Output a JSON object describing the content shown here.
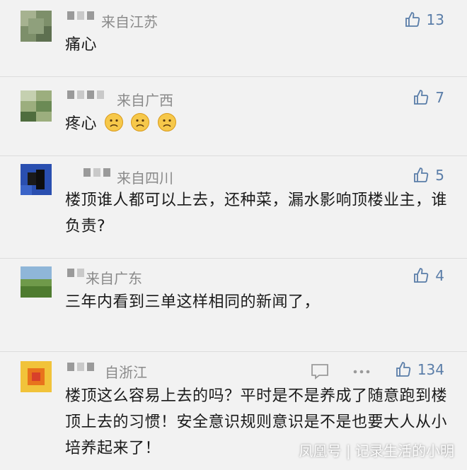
{
  "comments": [
    {
      "location": "来自江苏",
      "likes": "13",
      "text": "痛心"
    },
    {
      "location": "来自广西",
      "likes": "7",
      "text": "疼心"
    },
    {
      "location": "来自四川",
      "likes": "5",
      "text": "楼顶谁人都可以上去，还种菜，漏水影响顶楼业主，谁负责?"
    },
    {
      "location": "来自广东",
      "likes": "4",
      "text": "三年内看到三单这样相同的新闻了，"
    },
    {
      "location": "自浙江",
      "likes": "134",
      "text": "楼顶这么容易上去的吗？平时是不是养成了随意跑到楼顶上去的习惯！安全意识规则意识是不是也要大人从小培养起来了！"
    }
  ],
  "watermark": "凤凰号 | 记录生活的小明",
  "colors": {
    "like_blue": "#5a7da8",
    "meta_gray": "#8a8a8a",
    "background": "#f2f2f2"
  },
  "icons": {
    "like": "thumbs-up-icon",
    "reply": "comment-bubble-icon",
    "more": "more-dots-icon",
    "emoji": "frowning-face-emoji"
  }
}
